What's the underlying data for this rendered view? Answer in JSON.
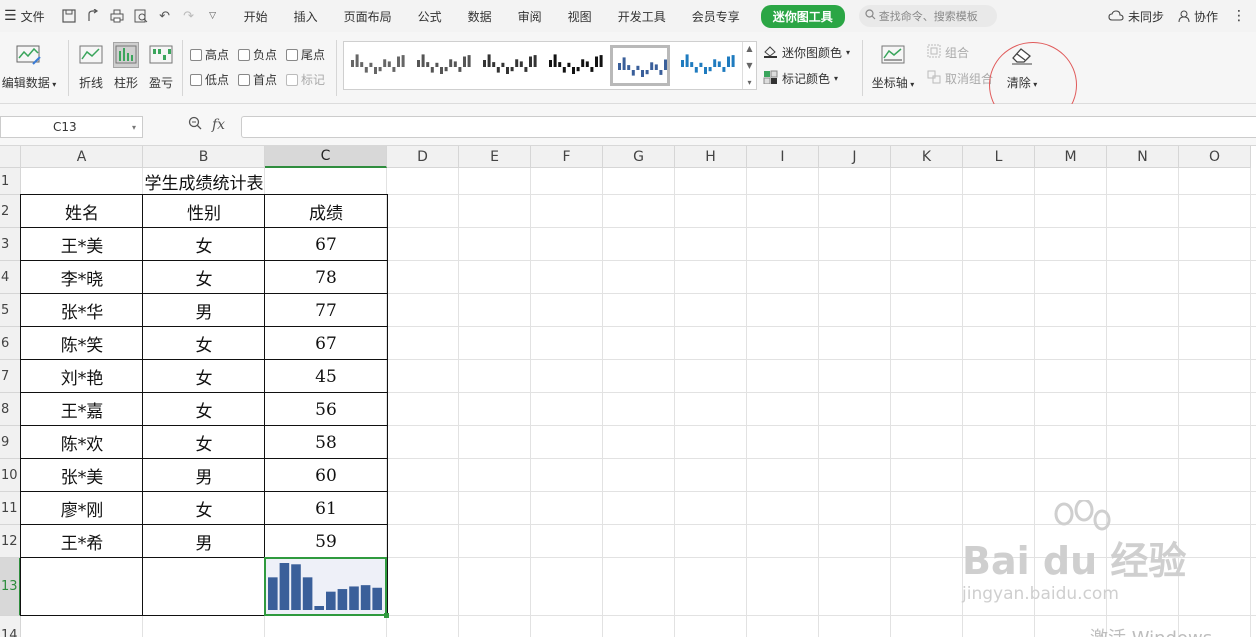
{
  "menubar": {
    "file_label": "文件",
    "menus": [
      "开始",
      "插入",
      "页面布局",
      "公式",
      "数据",
      "审阅",
      "视图",
      "开发工具",
      "会员专享"
    ],
    "active_tab": "迷你图工具",
    "search_placeholder": "查找命令、搜索模板",
    "sync_label": "未同步",
    "collab_label": "协作"
  },
  "ribbon": {
    "edit_data": "编辑数据",
    "line": "折线",
    "column": "柱形",
    "winloss": "盈亏",
    "checkboxes": {
      "high": "高点",
      "negative": "负点",
      "last": "尾点",
      "low": "低点",
      "first": "首点",
      "marker": "标记"
    },
    "sparkline_color": "迷你图颜色",
    "marker_color": "标记颜色",
    "axis": "坐标轴",
    "group": "组合",
    "ungroup": "取消组合",
    "clear": "清除"
  },
  "formula_bar": {
    "cell_ref": "C13",
    "fx": "fx",
    "formula": ""
  },
  "columns": [
    "A",
    "B",
    "C",
    "D",
    "E",
    "F",
    "G",
    "H",
    "I",
    "J",
    "K",
    "L",
    "M",
    "N",
    "O"
  ],
  "rows": [
    "1",
    "2",
    "3",
    "4",
    "5",
    "6",
    "7",
    "8",
    "9",
    "10",
    "11",
    "12",
    "13",
    "14"
  ],
  "sheet": {
    "title": "学生成绩统计表",
    "headers": [
      "姓名",
      "性别",
      "成绩"
    ],
    "records": [
      {
        "name": "王*美",
        "gender": "女",
        "score": "67"
      },
      {
        "name": "李*晓",
        "gender": "女",
        "score": "78"
      },
      {
        "name": "张*华",
        "gender": "男",
        "score": "77"
      },
      {
        "name": "陈*笑",
        "gender": "女",
        "score": "67"
      },
      {
        "name": "刘*艳",
        "gender": "女",
        "score": "45"
      },
      {
        "name": "王*嘉",
        "gender": "女",
        "score": "56"
      },
      {
        "name": "陈*欢",
        "gender": "女",
        "score": "58"
      },
      {
        "name": "张*美",
        "gender": "男",
        "score": "60"
      },
      {
        "name": "廖*刚",
        "gender": "女",
        "score": "61"
      },
      {
        "name": "王*希",
        "gender": "男",
        "score": "59"
      }
    ]
  },
  "sparkline": {
    "values": [
      67,
      78,
      77,
      67,
      45,
      56,
      58,
      60,
      61,
      59
    ],
    "color": "#3a5f9a"
  },
  "watermark": {
    "brand": "Bai du 经验",
    "url": "jingyan.baidu.com"
  },
  "activation_text": "激活 Windows"
}
